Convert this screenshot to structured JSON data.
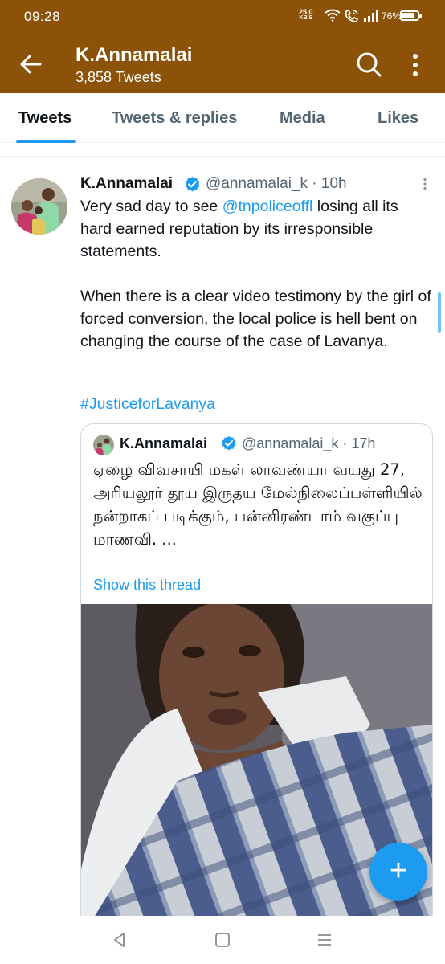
{
  "status_bar": {
    "time": "09:28",
    "network_speed": "25.0",
    "network_speed_unit": "KB/S",
    "battery": "76%",
    "battery_level": 0.76
  },
  "header": {
    "title": "K.Annamalai",
    "subtitle": "3,858 Tweets",
    "background_color": "#8b5208"
  },
  "tabs": [
    {
      "label": "Tweets",
      "active": true
    },
    {
      "label": "Tweets & replies",
      "active": false
    },
    {
      "label": "Media",
      "active": false
    },
    {
      "label": "Likes",
      "active": false
    }
  ],
  "tweet": {
    "name": "K.Annamalai",
    "handle_time": "@annamalai_k · 10h",
    "body_pre": "Very sad day to see ",
    "mention": "@tnpoliceoffl",
    "body_post": " losing all its hard earned reputation by its irresponsible statements.",
    "body_2": "When there is a clear video testimony by the girl of forced conversion, the local police is hell bent on changing the course of the case of Lavanya.",
    "hashtag": "#JusticeforLavanya"
  },
  "quote": {
    "name": "K.Annamalai",
    "handle_time": "@annamalai_k · 17h",
    "body": "ஏழை விவசாயி மகள் லாவண்யா வயது 27, அரியலூர் தூய இருதய மேல்நிலைப்பள்ளியில் நன்றாகப் படிக்கும், பன்னிரண்டாம் வகுப்பு மாணவி. ...",
    "show_thread": "Show this thread"
  },
  "accent_color": "#1d9bf0"
}
